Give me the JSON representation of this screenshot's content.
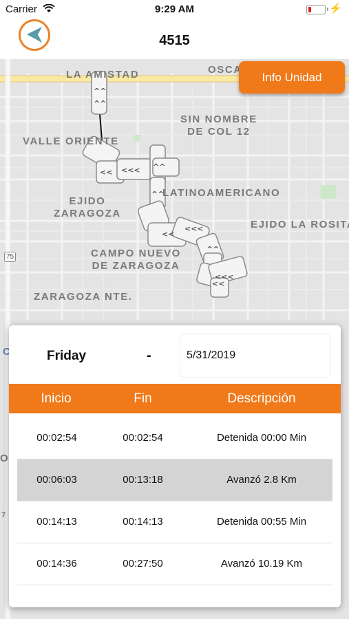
{
  "status_bar": {
    "carrier": "Carrier",
    "time": "9:29 AM"
  },
  "nav": {
    "title": "4515",
    "back_icon": "back-arrow-icon"
  },
  "map": {
    "labels": [
      "LA AMISTAD",
      "OSCA",
      "SIN NOMBRE\nDE COL 12",
      "VALLE ORIENTE",
      "EJIDO\nZARAGOZA",
      "LATINOAMERICANO",
      "EJIDO LA ROSITA",
      "CAMPO NUEVO\nDE ZARAGOZA",
      "ZARAGOZA NTE."
    ],
    "highway_shield": "75",
    "edge_letters": {
      "c": "C",
      "o": "O",
      "seven": "7"
    }
  },
  "info_button": "Info Unidad",
  "card": {
    "day": "Friday",
    "separator": "-",
    "date": "5/31/2019",
    "headers": {
      "start": "Inicio",
      "end": "Fin",
      "description": "Descripción"
    },
    "rows": [
      {
        "start": "00:02:54",
        "end": "00:02:54",
        "description": "Detenida 00:00 Min"
      },
      {
        "start": "00:06:03",
        "end": "00:13:18",
        "description": "Avanzó 2.8 Km"
      },
      {
        "start": "00:14:13",
        "end": "00:14:13",
        "description": "Detenida 00:55 Min"
      },
      {
        "start": "00:14:36",
        "end": "00:27:50",
        "description": "Avanzó 10.19 Km"
      }
    ]
  },
  "colors": {
    "accent": "#f07a1a",
    "back_teal": "#5b9aa8"
  }
}
